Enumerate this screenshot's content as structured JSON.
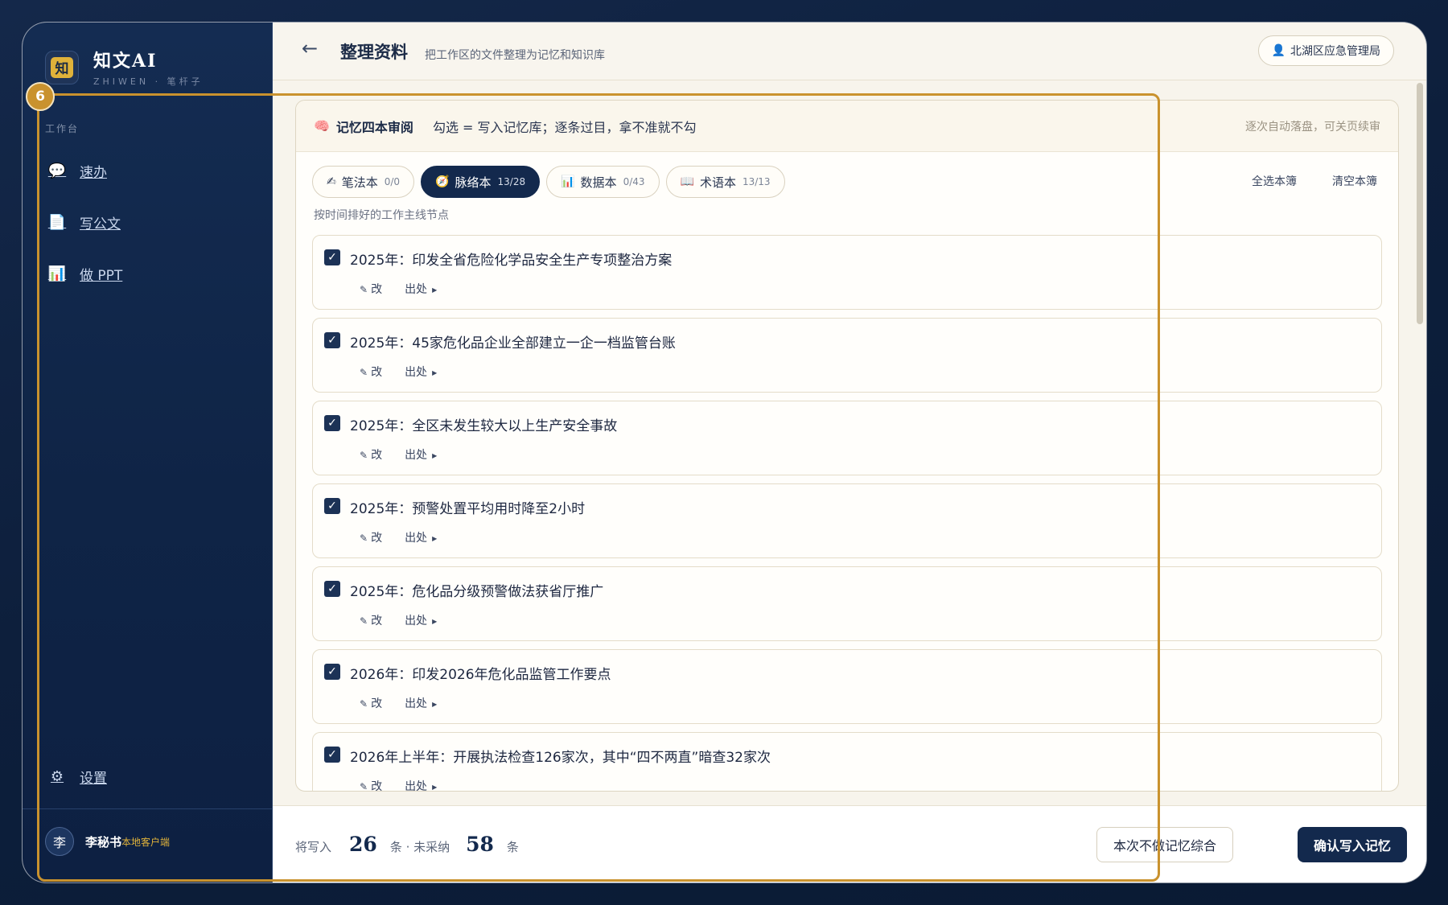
{
  "brand": {
    "logo_char": "知",
    "name": "知文AI",
    "sub": "ZHIWEN · 笔杆子"
  },
  "sidebar": {
    "section": "工作台",
    "items": [
      {
        "label": "速办",
        "icon": "speech-bubble-icon"
      },
      {
        "label": "写公文",
        "icon": "document-icon"
      },
      {
        "label": "做 PPT",
        "icon": "bar-chart-icon"
      }
    ],
    "settings": "设置"
  },
  "user": {
    "avatar": "李",
    "name": "李秘书",
    "role": "本地客户端"
  },
  "header": {
    "back": "←",
    "title": "整理资料",
    "subtitle": "把工作区的文件整理为记忆和知识库",
    "org": "北湖区应急管理局"
  },
  "step_badge": "6",
  "card": {
    "title": "记忆四本审阅",
    "desc": "勾选 = 写入记忆库；逐条过目，拿不准就不勾",
    "right": "逐次自动落盘，可关页续审"
  },
  "tabs": [
    {
      "label": "笔法本",
      "count": "0/0",
      "icon": "✍"
    },
    {
      "label": "脉络本",
      "count": "13/28",
      "icon": "🧭"
    },
    {
      "label": "数据本",
      "count": "0/43",
      "icon": "📊"
    },
    {
      "label": "术语本",
      "count": "13/13",
      "icon": "📖"
    }
  ],
  "tab_actions": {
    "select_all": "全选本簿",
    "clear": "清空本簿"
  },
  "hint": "按时间排好的工作主线节点",
  "item_actions": {
    "edit": "改",
    "source": "出处"
  },
  "items": [
    "2025年：印发全省危险化学品安全生产专项整治方案",
    "2025年：45家危化品企业全部建立一企一档监管台账",
    "2025年：全区未发生较大以上生产安全事故",
    "2025年：预警处置平均用时降至2小时",
    "2025年：危化品分级预警做法获省厅推广",
    "2026年：印发2026年危化品监管工作要点",
    "2026年上半年：开展执法检查126家次，其中“四不两直”暗查32家次"
  ],
  "footer": {
    "will_write": "将写入",
    "will_write_count": "26",
    "unit": "条",
    "sep": "条 · 未采纳",
    "rejected_count": "58",
    "skip": "本次不做记忆综合",
    "confirm": "确认写入记忆"
  },
  "colors": {
    "navy": "#13294d",
    "gold": "#c9922e",
    "accent_yellow": "#e0b23a"
  }
}
